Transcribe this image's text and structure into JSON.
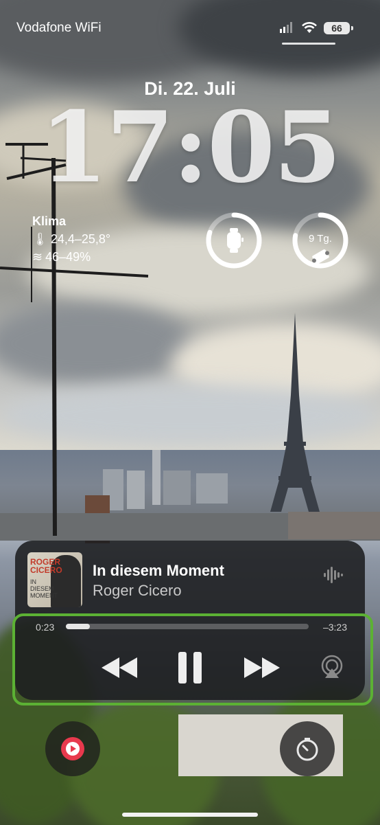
{
  "status_bar": {
    "carrier": "Vodafone WiFi",
    "battery": "66"
  },
  "lock_screen": {
    "date": "Di. 22. Juli",
    "time": "17:05"
  },
  "widgets": {
    "klima": {
      "title": "Klima",
      "temperature": "24,4–25,8°",
      "humidity": "46–49%"
    },
    "watch_ring": {
      "icon": "watch-icon",
      "progress": 0.8
    },
    "countdown_ring": {
      "label": "9 Tg.",
      "icon": "ticket-icon",
      "progress": 0.78
    }
  },
  "now_playing": {
    "album_art": {
      "artist_text": "ROGER CICERO",
      "album_text": "IN DIESEM MOMENT"
    },
    "title": "In diesem Moment",
    "artist": "Roger Cicero",
    "elapsed": "0:23",
    "remaining": "–3:23",
    "progress": 0.1,
    "controls": [
      "rewind-icon",
      "pause-icon",
      "fast-forward-icon",
      "airplay-icon"
    ]
  },
  "bottom_buttons": {
    "left": "music-app-icon",
    "right": "timer-icon"
  },
  "colors": {
    "highlight": "#5cb134",
    "music_red": "#e8394d"
  }
}
